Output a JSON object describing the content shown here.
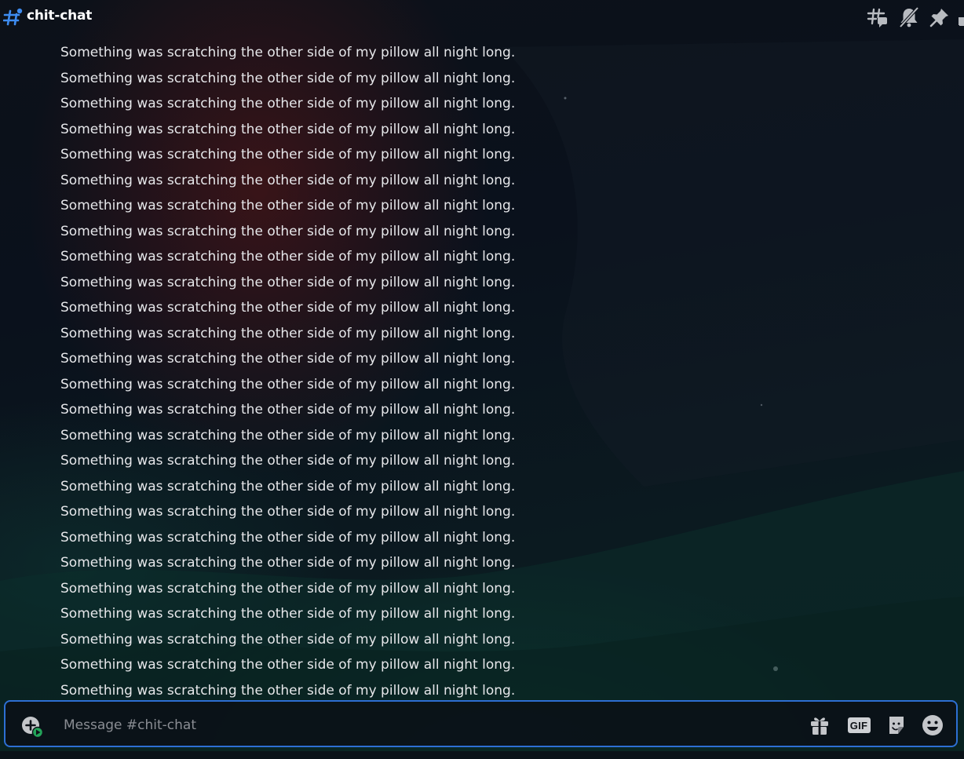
{
  "header": {
    "channel_name": "chit-chat",
    "icons": [
      "threads-icon",
      "notifications-muted-icon",
      "pin-icon"
    ]
  },
  "messages": [
    "Something was scratching the other side of my pillow all night long.",
    "Something was scratching the other side of my pillow all night long.",
    "Something was scratching the other side of my pillow all night long.",
    "Something was scratching the other side of my pillow all night long.",
    "Something was scratching the other side of my pillow all night long.",
    "Something was scratching the other side of my pillow all night long.",
    "Something was scratching the other side of my pillow all night long.",
    "Something was scratching the other side of my pillow all night long.",
    "Something was scratching the other side of my pillow all night long.",
    "Something was scratching the other side of my pillow all night long.",
    "Something was scratching the other side of my pillow all night long.",
    "Something was scratching the other side of my pillow all night long.",
    "Something was scratching the other side of my pillow all night long.",
    "Something was scratching the other side of my pillow all night long.",
    "Something was scratching the other side of my pillow all night long.",
    "Something was scratching the other side of my pillow all night long.",
    "Something was scratching the other side of my pillow all night long.",
    "Something was scratching the other side of my pillow all night long.",
    "Something was scratching the other side of my pillow all night long.",
    "Something was scratching the other side of my pillow all night long.",
    "Something was scratching the other side of my pillow all night long.",
    "Something was scratching the other side of my pillow all night long.",
    "Something was scratching the other side of my pillow all night long.",
    "Something was scratching the other side of my pillow all night long.",
    "Something was scratching the other side of my pillow all night long.",
    "Something was scratching the other side of my pillow all night long."
  ],
  "composer": {
    "placeholder": "Message #chit-chat",
    "value": "",
    "gif_label": "GIF",
    "icons": [
      "attach-plus-icon",
      "gift-icon",
      "gif-icon",
      "sticker-icon",
      "emoji-icon"
    ]
  },
  "colors": {
    "accent_border": "#2d6fd3",
    "text": "#e6e7ea",
    "placeholder": "#8a8d93",
    "channel_icon": "#3e8cf0",
    "attach_badge": "#23a55a"
  }
}
